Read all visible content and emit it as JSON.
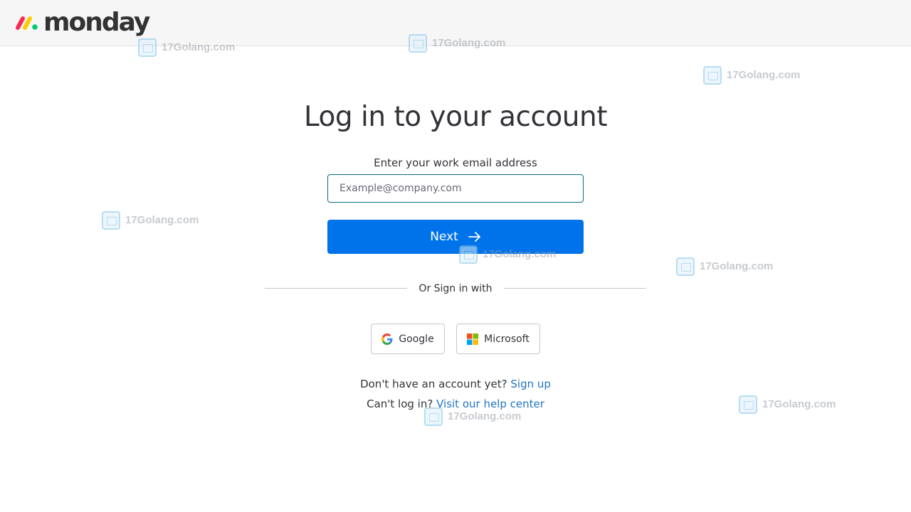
{
  "header": {
    "logo_text": "monday",
    "logo_colors": [
      "#f62b54",
      "#ffcb00",
      "#00ca72"
    ]
  },
  "login": {
    "title": "Log in to your account",
    "email_label": "Enter your work email address",
    "email_value": "",
    "email_placeholder": "Example@company.com",
    "next_label": "Next",
    "divider_text": "Or Sign in with",
    "google_label": "Google",
    "microsoft_label": "Microsoft",
    "signup_prompt": "Don't have an account yet?",
    "signup_link": "Sign up",
    "help_prompt": "Can't log in?",
    "help_link": "Visit our help center"
  },
  "colors": {
    "primary": "#0073ea",
    "link": "#1f76c2",
    "input_border": "#0b6b8a"
  },
  "icons": {
    "next": "arrow-right-icon",
    "google": "google-icon",
    "microsoft": "microsoft-icon"
  },
  "watermark": {
    "text": "17Golang.com"
  }
}
